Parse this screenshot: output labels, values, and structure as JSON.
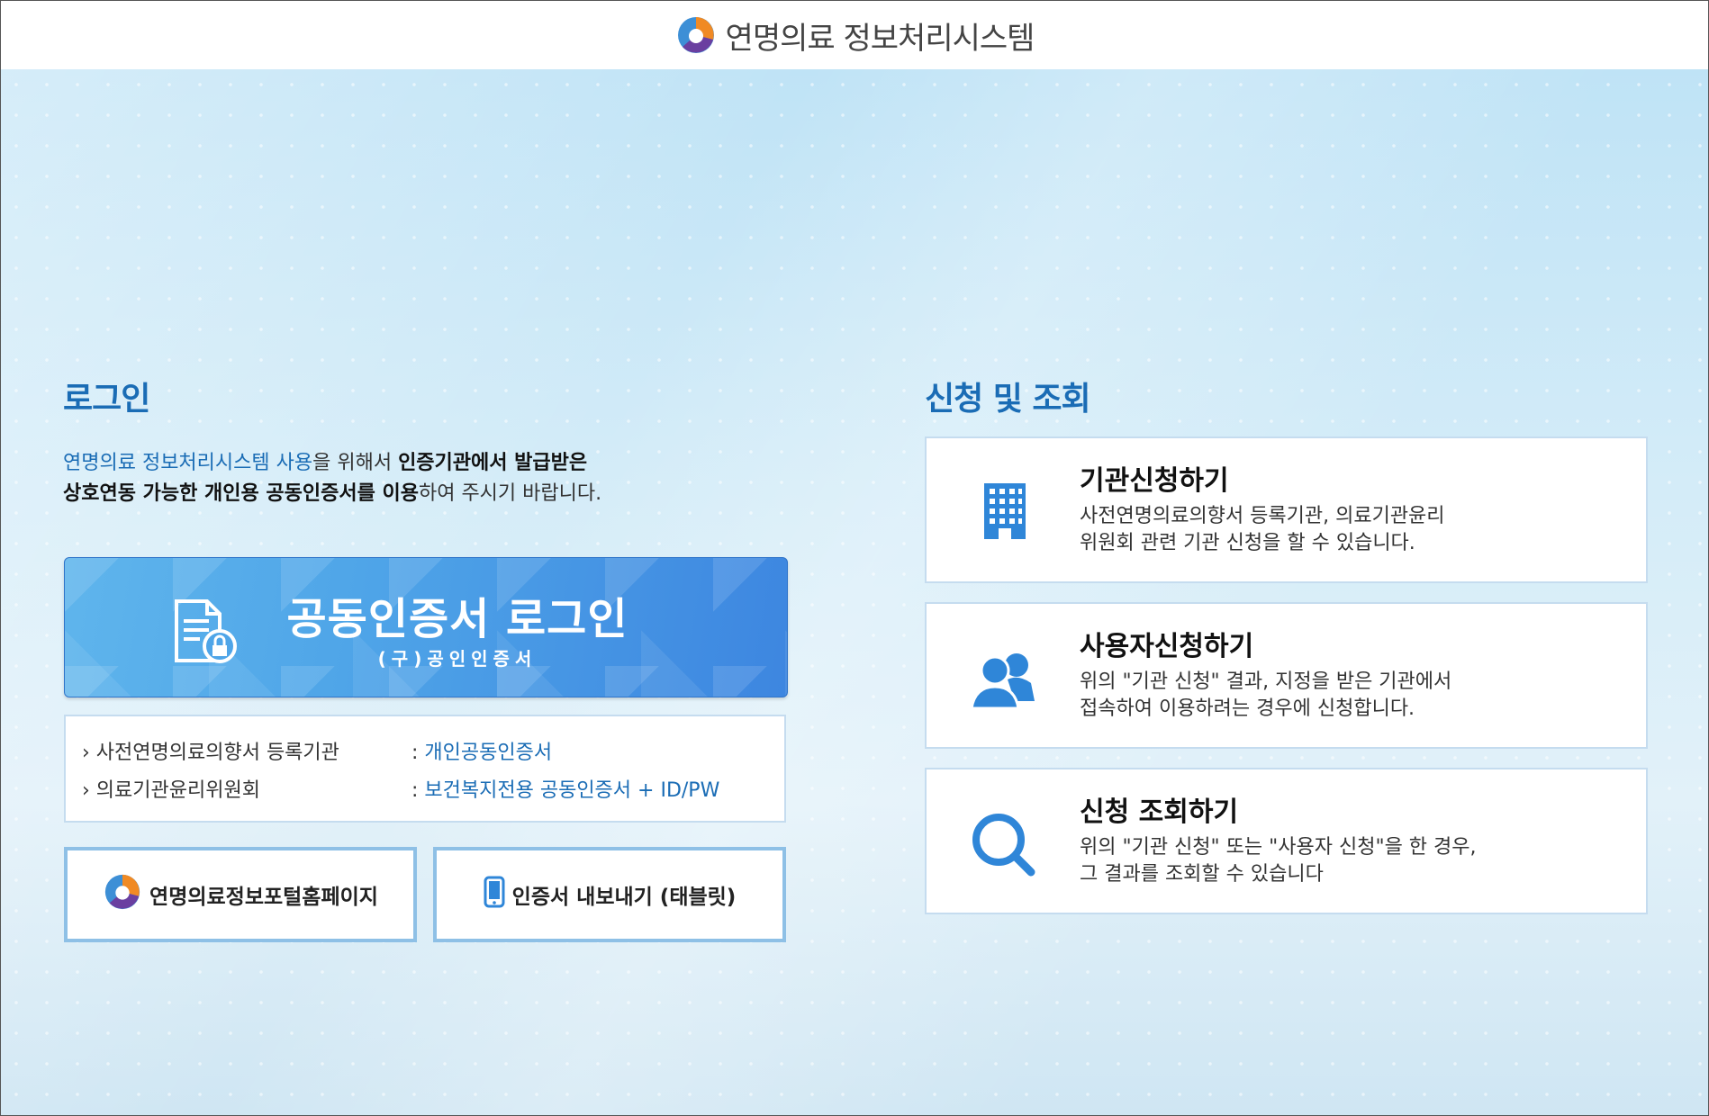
{
  "header": {
    "title": "연명의료 정보처리시스템"
  },
  "login": {
    "heading": "로그인",
    "desc_blue": "연명의료 정보처리시스템 사용",
    "desc_1": "을 위해서 ",
    "desc_bold1": "인증기관에서 발급받은",
    "desc_bold2": "상호연동 가능한 개인용 공동인증서를 이용",
    "desc_2": "하여 주시기 바랍니다.",
    "cert_button": {
      "label": "공동인증서 로그인",
      "sub": "(구)공인인증서"
    },
    "info": [
      {
        "name": "› 사전연명의료의향서 등록기관",
        "colon": ": ",
        "value": "개인공동인증서"
      },
      {
        "name": "› 의료기관윤리위원회",
        "colon": ": ",
        "value": "보건복지전용 공동인증서 + ID/PW"
      }
    ],
    "portal_button": "연명의료정보포털홈페이지",
    "export_button": "인증서 내보내기 (태블릿)"
  },
  "apply": {
    "heading": "신청 및 조회",
    "cards": [
      {
        "title": "기관신청하기",
        "desc": "사전연명의료의향서 등록기관, 의료기관윤리\n위원회 관련 기관 신청을 할 수 있습니다.",
        "icon": "building-icon"
      },
      {
        "title": "사용자신청하기",
        "desc": "위의 \"기관 신청\" 결과, 지정을 받은 기관에서\n접속하여 이용하려는 경우에 신청합니다.",
        "icon": "users-icon"
      },
      {
        "title": "신청 조회하기",
        "desc": "위의 \"기관 신청\" 또는 \"사용자 신청\"을 한 경우,\n그 결과를 조회할 수 있습니다",
        "icon": "search-icon"
      }
    ]
  },
  "colors": {
    "accent": "#1a6cb5",
    "button_blue": "#4fa5e8",
    "border": "#c5dcef"
  }
}
